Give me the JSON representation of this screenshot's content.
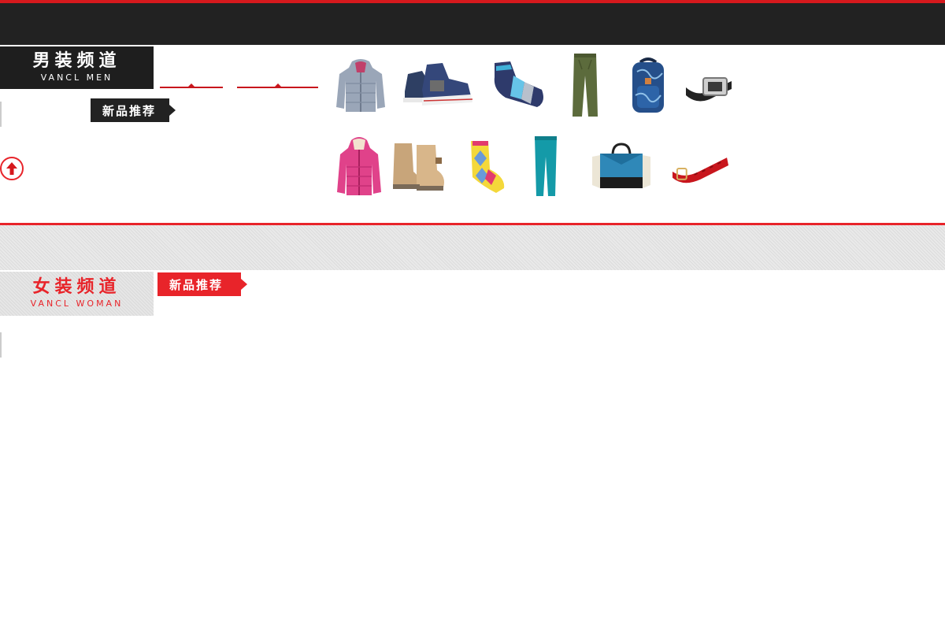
{
  "men_channel": {
    "title_cn": "男装频道",
    "title_en": "VANCL MEN",
    "badge": "新品推荐"
  },
  "women_channel": {
    "title_cn": "女装频道",
    "title_en": "VANCL WOMAN",
    "badge": "新品推荐"
  },
  "colors": {
    "accent_red": "#e8242a",
    "dark": "#222222"
  },
  "products_row1": [
    {
      "icon": "puffer-jacket-grey-icon"
    },
    {
      "icon": "high-top-sneaker-navy-icon"
    },
    {
      "icon": "striped-sock-blue-icon"
    },
    {
      "icon": "chino-pants-olive-icon"
    },
    {
      "icon": "backpack-blue-print-icon"
    },
    {
      "icon": "leather-belt-black-icon"
    }
  ],
  "products_row2": [
    {
      "icon": "puffer-jacket-pink-icon"
    },
    {
      "icon": "snow-boots-tan-icon"
    },
    {
      "icon": "argyle-sock-yellow-icon"
    },
    {
      "icon": "skinny-jeans-teal-icon"
    },
    {
      "icon": "handbag-blue-icon"
    },
    {
      "icon": "woven-belt-red-icon"
    }
  ]
}
